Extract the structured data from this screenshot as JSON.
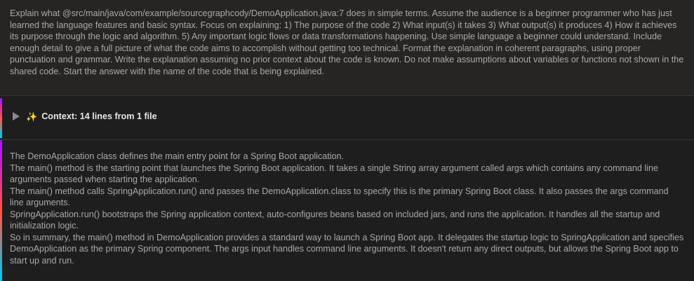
{
  "human_message": {
    "text": "Explain what @src/main/java/com/example/sourcegraphcody/DemoApplication.java:7 does in simple terms. Assume the audience is a beginner programmer who has just learned the language features and basic syntax. Focus on explaining: 1) The purpose of the code 2) What input(s) it takes 3) What output(s) it produces 4) How it achieves its purpose through the logic and algorithm. 5) Any important logic flows or data transformations happening. Use simple language a beginner could understand. Include enough detail to give a full picture of what the code aims to accomplish without getting too technical. Format the explanation in coherent paragraphs, using proper punctuation and grammar. Write the explanation assuming no prior context about the code is known. Do not make assumptions about variables or functions not shown in the shared code. Start the answer with the name of the code that is being explained."
  },
  "context": {
    "sparkle": "✨",
    "label": "Context: 14 lines from 1 file"
  },
  "assistant_message": {
    "paragraphs": [
      "The DemoApplication class defines the main entry point for a Spring Boot application.",
      "The main() method is the starting point that launches the Spring Boot application. It takes a single String array argument called args which contains any command line arguments passed when starting the application.",
      "The main() method calls SpringApplication.run() and passes the DemoApplication.class to specify this is the primary Spring Boot class. It also passes the args command line arguments.",
      "SpringApplication.run() bootstraps the Spring application context, auto-configures beans based on included jars, and runs the application. It handles all the startup and initialization logic.",
      "So in summary, the main() method in DemoApplication provides a standard way to launch a Spring Boot app. It delegates the startup logic to SpringApplication and specifies DemoApplication as the primary Spring component. The args input handles command line arguments. It doesn't return any direct outputs, but allows the Spring Boot app to start up and run."
    ]
  },
  "colors": {
    "background": "#1e1e1e",
    "human_background": "#272524",
    "text": "#a9a9a9",
    "accent_gradient": [
      "#a112ff",
      "#ff5543",
      "#00cbec"
    ]
  }
}
